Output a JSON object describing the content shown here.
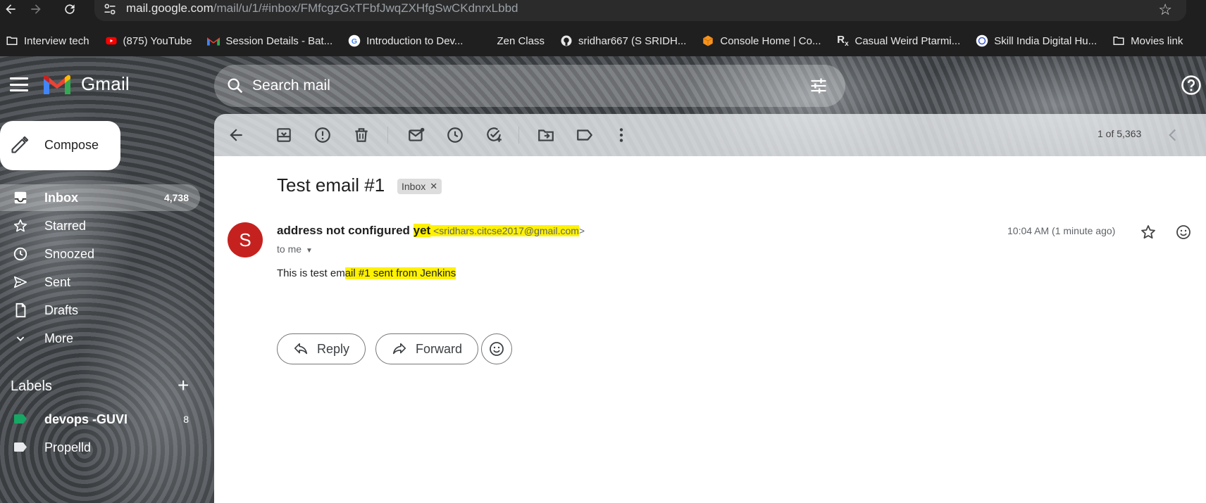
{
  "browser": {
    "url_host": "mail.google.com",
    "url_path": "/mail/u/1/#inbox/FMfcgzGxTFbfJwqZXHfgSwCKdnrxLbbd",
    "bookmarks": [
      {
        "label": "Interview tech",
        "icon": "folder-icon"
      },
      {
        "label": "(875) YouTube",
        "icon": "youtube-icon"
      },
      {
        "label": "Session Details - Bat...",
        "icon": "gmail-icon"
      },
      {
        "label": "Introduction to Dev...",
        "icon": "google-icon"
      },
      {
        "label": "Zen Class",
        "icon": "blank-icon"
      },
      {
        "label": "sridhar667 (S SRIDH...",
        "icon": "github-icon"
      },
      {
        "label": "Console Home | Co...",
        "icon": "aws-cube-icon"
      },
      {
        "label": "Casual Weird Ptarmi...",
        "icon": "rx-icon"
      },
      {
        "label": "Skill India Digital Hu...",
        "icon": "skill-india-icon"
      },
      {
        "label": "Movies link",
        "icon": "folder-icon"
      }
    ]
  },
  "gmail": {
    "brand": "Gmail",
    "search_placeholder": "Search mail",
    "compose_label": "Compose",
    "nav": [
      {
        "label": "Inbox",
        "count": "4,738",
        "icon": "inbox-icon",
        "active": true
      },
      {
        "label": "Starred",
        "count": "",
        "icon": "star-icon"
      },
      {
        "label": "Snoozed",
        "count": "",
        "icon": "clock-icon"
      },
      {
        "label": "Sent",
        "count": "",
        "icon": "send-icon"
      },
      {
        "label": "Drafts",
        "count": "",
        "icon": "draft-icon"
      },
      {
        "label": "More",
        "count": "",
        "icon": "chevron-down-icon"
      }
    ],
    "labels_title": "Labels",
    "labels": [
      {
        "name": "devops -GUVI",
        "count": "8",
        "color": "#16a765"
      },
      {
        "name": "Propelld",
        "count": "",
        "color": "#e8eaed"
      }
    ],
    "pager": "1 of 5,363"
  },
  "email": {
    "subject": "Test email #1",
    "chip": "Inbox",
    "avatar_letter": "S",
    "sender_name_plain": "address not configured ",
    "sender_name_highlight": "yet",
    "sender_email_hl": " <sridhars.citcse2017@gmail.com",
    "sender_email_end": ">",
    "to_me": "to me",
    "time": "10:04 AM (1 minute ago)",
    "body_plain": "This is test em",
    "body_highlight": "ail #1 sent from Jenkins ",
    "reply_label": "Reply",
    "forward_label": "Forward"
  },
  "colors": {
    "highlight": "#fff200",
    "avatar": "#c5221f"
  }
}
